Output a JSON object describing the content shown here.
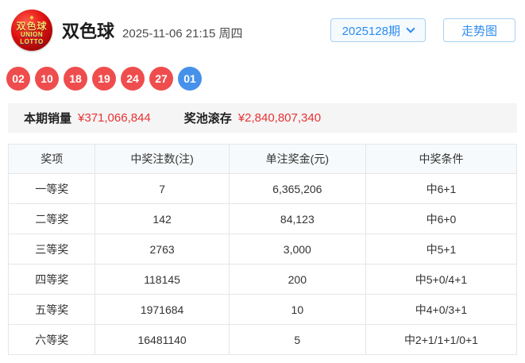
{
  "header": {
    "logo": {
      "diamond": "◆",
      "line1": "双色球",
      "line2": "UNION",
      "line3": "LOTTO"
    },
    "title": "双色球",
    "datetime": "2025-11-06 21:15 周四",
    "issue_selector": "2025128期",
    "trend_button": "走势图"
  },
  "balls": {
    "red": [
      "02",
      "10",
      "18",
      "19",
      "24",
      "27"
    ],
    "blue": [
      "01"
    ]
  },
  "stats": {
    "sales_label": "本期销量",
    "sales_value": "¥371,066,844",
    "pool_label": "奖池滚存",
    "pool_value": "¥2,840,807,340"
  },
  "table": {
    "headers": [
      "奖项",
      "中奖注数(注)",
      "单注奖金(元)",
      "中奖条件"
    ],
    "rows": [
      [
        "一等奖",
        "7",
        "6,365,206",
        "中6+1"
      ],
      [
        "二等奖",
        "142",
        "84,123",
        "中6+0"
      ],
      [
        "三等奖",
        "2763",
        "3,000",
        "中5+1"
      ],
      [
        "四等奖",
        "118145",
        "200",
        "中5+0/4+1"
      ],
      [
        "五等奖",
        "1971684",
        "10",
        "中4+0/3+1"
      ],
      [
        "六等奖",
        "16481140",
        "5",
        "中2+1/1+1/0+1"
      ]
    ]
  },
  "colors": {
    "red_ball": "#ef4d4d",
    "blue_ball": "#4691e9",
    "accent_red": "#e83232",
    "button_blue": "#2d8cf0",
    "button_border": "#a6d1f2",
    "table_header_bg": "#f7fafc",
    "stats_bg": "#f5f5f5"
  }
}
